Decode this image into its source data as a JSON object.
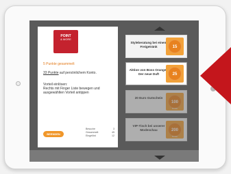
{
  "logo": {
    "line1": "POINT",
    "line2": "& MORE"
  },
  "left_panel": {
    "collected": "5 Punkte gesammelt",
    "points_value": "33 Punkte",
    "points_text": " auf persönlichem Konto.",
    "redeem_title": "Vorteil einlösen:",
    "redeem_text": "Rechts mit Finger Liste bewegen und ausgewählten Vorteil antippen",
    "button": "BEENDEN",
    "stats": [
      {
        "label": "Besuche",
        "value": "3"
      },
      {
        "label": "Gesammelt",
        "value": "45"
      },
      {
        "label": "Eingelöst",
        "value": "12"
      }
    ]
  },
  "rewards": [
    {
      "title": "Styleberatung bei einem Freigetränk",
      "points": "15",
      "sub": ""
    },
    {
      "title": "Aktion von Boss Orange - Der neue Duft",
      "points": "25",
      "sub": ""
    },
    {
      "title": "20 Euro Gutschein",
      "points": "100",
      "sub": "Punkte"
    },
    {
      "title": "VIP-Tisch bei unserer Modeschau",
      "points": "200",
      "sub": "Punkte"
    }
  ],
  "colors": {
    "accent": "#f0972a",
    "brand": "#c4222e",
    "highlight_arrow": "#c4161c"
  }
}
